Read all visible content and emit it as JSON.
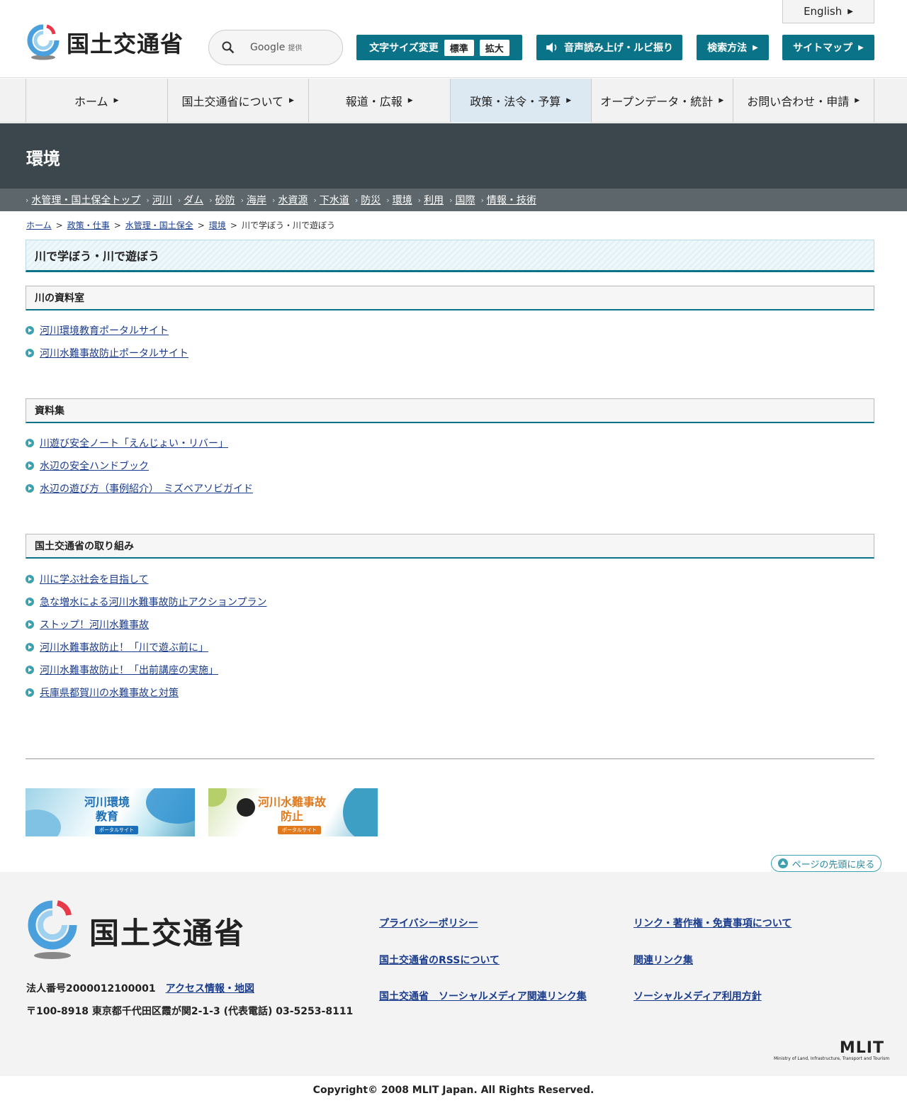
{
  "header": {
    "logo_text": "国土交通省",
    "english": "English",
    "search_provider": "Google",
    "search_provider_suffix": "提供",
    "font_size_label": "文字サイズ変更",
    "font_standard": "標準",
    "font_large": "拡大",
    "voice_label": "音声読み上げ・ルビ振り",
    "search_method": "検索方法",
    "sitemap": "サイトマップ"
  },
  "gnav": [
    {
      "label": "ホーム"
    },
    {
      "label": "国土交通省について"
    },
    {
      "label": "報道・広報"
    },
    {
      "label": "政策・法令・予算"
    },
    {
      "label": "オープンデータ・統計"
    },
    {
      "label": "お問い合わせ・申請"
    }
  ],
  "page_header": {
    "title": "環境"
  },
  "subnav": [
    "水管理・国土保全トップ",
    "河川",
    "ダム",
    "砂防",
    "海岸",
    "水資源",
    "下水道",
    "防災",
    "環境",
    "利用",
    "国際",
    "情報・技術"
  ],
  "breadcrumb": {
    "links": [
      "ホーム",
      "政策・仕事",
      "水管理・国土保全",
      "環境"
    ],
    "separator": ">",
    "current": "川で学ぼう・川で遊ぼう"
  },
  "main": {
    "title": "川で学ぼう・川で遊ぼう",
    "sections": [
      {
        "heading": "川の資料室",
        "links": [
          "河川環境教育ポータルサイト",
          "河川水難事故防止ポータルサイト"
        ]
      },
      {
        "heading": "資料集",
        "links": [
          "川遊び安全ノート「えんじょい・リバー」",
          "水辺の安全ハンドブック",
          "水辺の遊び方（事例紹介）　ミズベアソビガイド"
        ]
      },
      {
        "heading": "国土交通省の取り組み",
        "links": [
          "川に学ぶ社会を目指して",
          "急な増水による河川水難事故防止アクションプラン",
          "ストップ！河川水難事故",
          "河川水難事故防止！「川で遊ぶ前に」",
          "河川水難事故防止！「出前講座の実施」",
          "兵庫県都賀川の水難事故と対策"
        ]
      }
    ]
  },
  "banners": [
    {
      "title": "河川環境教育",
      "tag": "ポータルサイト",
      "color": "#1b6fb8"
    },
    {
      "title": "河川水難事故防止",
      "tag": "ポータルサイト",
      "color": "#e07a1c"
    }
  ],
  "to_top": "ページの先頭に戻る",
  "footer": {
    "logo_text": "国土交通省",
    "corp_number": "法人番号2000012100001",
    "access": "アクセス情報・地図",
    "address": "〒100-8918 東京都千代田区霞が関2-1-3 (代表電話) 03-5253-8111",
    "links": [
      "プライバシーポリシー",
      "リンク・著作権・免責事項について",
      "国土交通省のRSSについて",
      "関連リンク集",
      "国土交通省　ソーシャルメディア関連リンク集",
      "ソーシャルメディア利用方針"
    ],
    "mlit_logo": "MLIT",
    "mlit_sub": "Ministry of Land, Infrastructure, Transport and Tourism"
  },
  "copyright": "Copyright© 2008 MLIT Japan. All Rights Reserved.",
  "colors": {
    "accent": "#0b7388",
    "page_header_bg": "#3b474d",
    "subnav_bg": "#5c666b",
    "link": "#1a3c8c"
  }
}
